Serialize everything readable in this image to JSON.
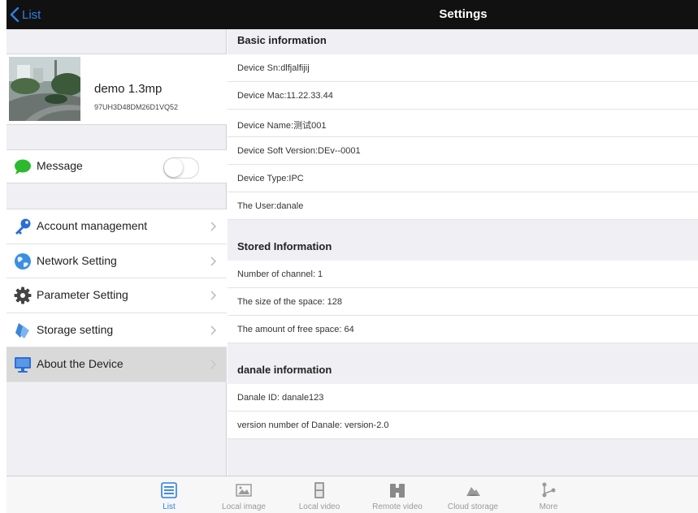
{
  "nav": {
    "back_label": "List",
    "title": "Settings"
  },
  "device": {
    "name": "demo 1.3mp",
    "id": "97UH3D48DM26D1VQ52"
  },
  "message": {
    "label": "Message",
    "enabled": false
  },
  "menu": [
    {
      "label": "Account management",
      "icon": "key-icon"
    },
    {
      "label": "Network Setting",
      "icon": "globe-icon"
    },
    {
      "label": "Parameter Setting",
      "icon": "gear-icon"
    },
    {
      "label": "Storage setting",
      "icon": "storage-icon"
    },
    {
      "label": "About the Device",
      "icon": "monitor-icon",
      "selected": true
    }
  ],
  "sections": {
    "basic": {
      "title": "Basic information",
      "rows": [
        "Device Sn:dlfjalfijij",
        "Device Mac:11.22.33.44",
        "Device Name:测试001",
        "Device Soft Version:DEv--0001",
        "Device Type:IPC",
        "The User:danale"
      ]
    },
    "stored": {
      "title": "Stored Information",
      "rows": [
        "Number of channel: 1",
        "The size of the space: 128",
        "The amount of free space: 64"
      ]
    },
    "danale": {
      "title": "danale information",
      "rows": [
        "Danale ID: danale123",
        "version number of Danale: version-2.0"
      ]
    }
  },
  "tabs": [
    {
      "label": "List",
      "icon": "list-icon",
      "active": true
    },
    {
      "label": "Local image",
      "icon": "image-icon"
    },
    {
      "label": "Local video",
      "icon": "film-icon"
    },
    {
      "label": "Remote video",
      "icon": "binoculars-icon"
    },
    {
      "label": "Cloud storage",
      "icon": "cloud-icon"
    },
    {
      "label": "More",
      "icon": "share-icon"
    }
  ],
  "colors": {
    "accent": "#2f7fe6",
    "topbar": "#111111",
    "message_icon": "#2db92d"
  }
}
